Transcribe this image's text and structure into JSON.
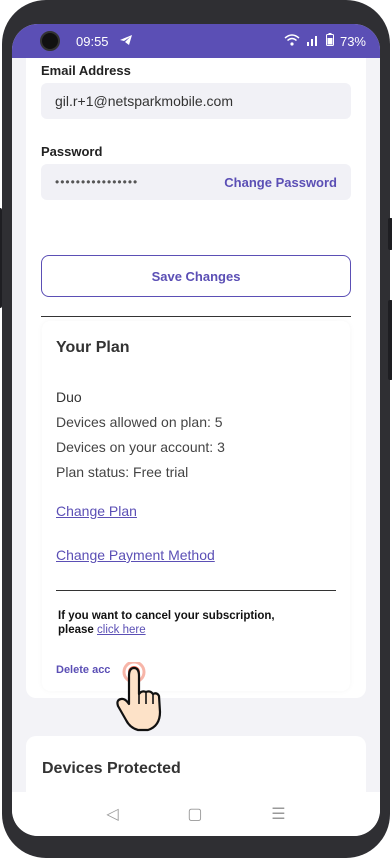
{
  "status_bar": {
    "time": "09:55",
    "battery": "73%"
  },
  "account": {
    "email_label": "Email Address",
    "email_value": "gil.r+1@netsparkmobile.com",
    "password_label": "Password",
    "password_value": "••••••••••••••••",
    "change_password": "Change Password",
    "save_changes": "Save Changes"
  },
  "plan": {
    "title": "Your Plan",
    "name": "Duo",
    "devices_allowed": "Devices allowed on plan: 5",
    "devices_on_account": "Devices on your account: 3",
    "plan_status": "Plan status: Free trial",
    "change_plan": "Change Plan",
    "change_payment": "Change Payment Method",
    "cancel_text_1": "If you want to cancel your subscription,",
    "cancel_text_2": "please",
    "cancel_link": "click here",
    "delete_account": "Delete acc"
  },
  "devices": {
    "title": "Devices Protected"
  },
  "nav": {
    "back": "◁",
    "home": "▢",
    "recents": "☰"
  },
  "colors": {
    "accent": "#5b4fb5",
    "background": "#f3f3f7"
  }
}
